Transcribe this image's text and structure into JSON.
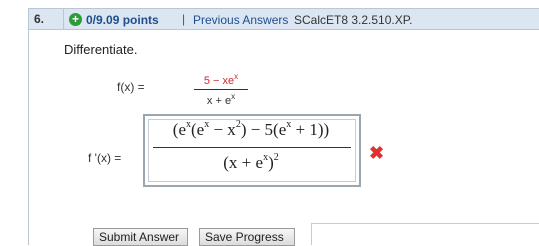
{
  "question": {
    "number": "6.",
    "points": "0/9.09 points",
    "separator": "|",
    "previous_answers_link": "Previous Answers",
    "id": "SCalcET8 3.2.510.XP."
  },
  "prompt": "Differentiate.",
  "function": {
    "label": "f(x) =",
    "numerator": "5 − xe",
    "numerator_exp": "x",
    "denominator": "x + e",
    "denominator_exp": "x"
  },
  "answer": {
    "label": "f '(x) =",
    "numerator_text": "(e^x(e^x − x^2) − 5(e^x + 1))",
    "denominator_text": "(x + e^x)^2",
    "status": "incorrect"
  },
  "buttons": {
    "submit": "Submit Answer",
    "save": "Save Progress"
  },
  "colors": {
    "header_bg": "#dbe6f2",
    "link": "#1f4e8c",
    "plus_icon": "#2e9b3a",
    "incorrect_x": "#e0302f",
    "highlight_red": "#cc2b2b"
  },
  "icons": {
    "points_icon": "plus-circle-icon",
    "status_icon": "x-mark-icon"
  }
}
